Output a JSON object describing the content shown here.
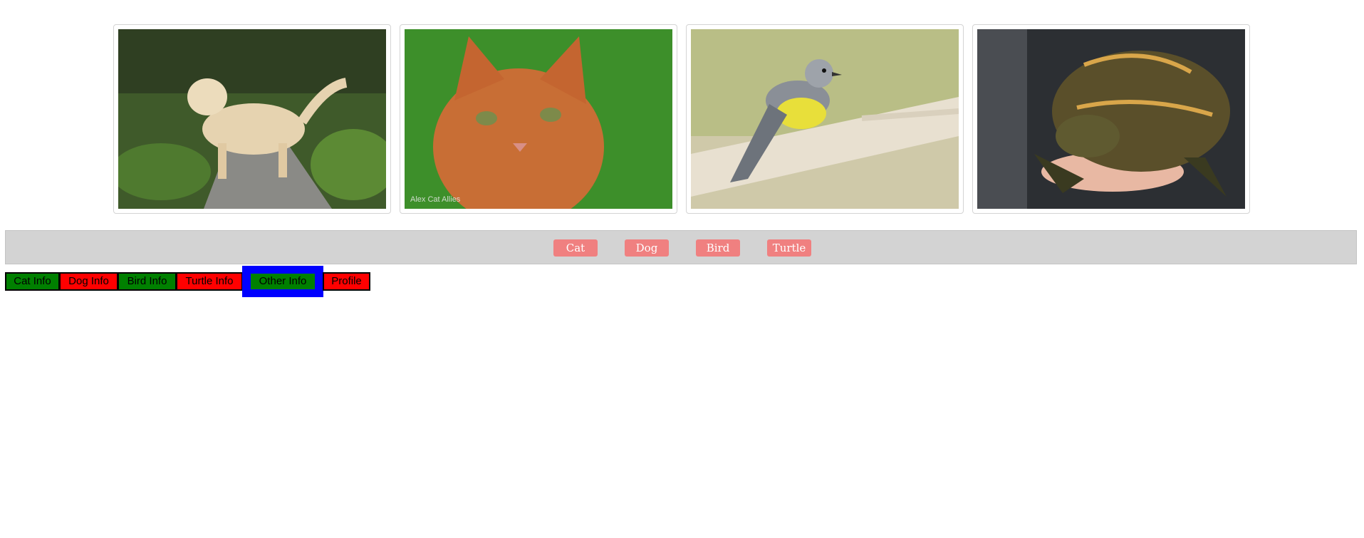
{
  "gallery": {
    "images": [
      {
        "subject": "dog"
      },
      {
        "subject": "cat",
        "watermark": "Alex Cat Allies"
      },
      {
        "subject": "bird"
      },
      {
        "subject": "turtle"
      }
    ]
  },
  "navbar": {
    "buttons": [
      {
        "label": "Cat"
      },
      {
        "label": "Dog"
      },
      {
        "label": "Bird"
      },
      {
        "label": "Turtle"
      }
    ]
  },
  "tabs": [
    {
      "label": "Cat Info",
      "color": "#008000"
    },
    {
      "label": "Dog Info",
      "color": "#ff0000"
    },
    {
      "label": "Bird Info",
      "color": "#008000"
    },
    {
      "label": "Turtle Info",
      "color": "#ff0000"
    },
    {
      "label": "Other Info",
      "color": "#008000",
      "focused": true
    },
    {
      "label": "Profile",
      "color": "#ff0000"
    }
  ],
  "colors": {
    "nav_bg": "#d3d3d3",
    "nav_button": "#f08080",
    "focus_ring": "#0000ff"
  }
}
